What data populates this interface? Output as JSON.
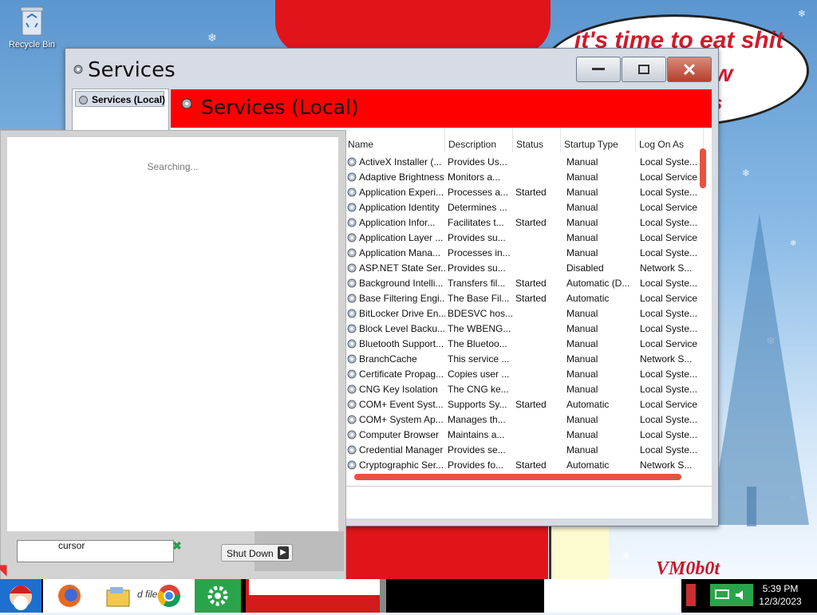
{
  "desktop": {
    "recycle_bin": "Recycle Bin",
    "bubble_line1": "it's time to eat shit",
    "bubble_line2": "hew",
    "bubble_line3": "s",
    "signature": "VM0b0t"
  },
  "window": {
    "title": "Services",
    "tree_item": "Services (Local)",
    "header": "Services (Local)",
    "columns": [
      "Name",
      "Description",
      "Status",
      "Startup Type",
      "Log On As"
    ],
    "rows": [
      [
        "ActiveX Installer (...",
        "Provides Us...",
        "",
        "Manual",
        "Local Syste..."
      ],
      [
        "Adaptive Brightness",
        "Monitors a...",
        "",
        "Manual",
        "Local Service"
      ],
      [
        "Application Experi...",
        "Processes a...",
        "Started",
        "Manual",
        "Local Syste..."
      ],
      [
        "Application Identity",
        "Determines ...",
        "",
        "Manual",
        "Local Service"
      ],
      [
        "Application Infor...",
        "Facilitates t...",
        "Started",
        "Manual",
        "Local Syste..."
      ],
      [
        "Application Layer ...",
        "Provides su...",
        "",
        "Manual",
        "Local Service"
      ],
      [
        "Application Mana...",
        "Processes in...",
        "",
        "Manual",
        "Local Syste..."
      ],
      [
        "ASP.NET State Ser...",
        "Provides su...",
        "",
        "Disabled",
        "Network S..."
      ],
      [
        "Background Intelli...",
        "Transfers fil...",
        "Started",
        "Automatic (D...",
        "Local Syste..."
      ],
      [
        "Base Filtering Engi...",
        "The Base Fil...",
        "Started",
        "Automatic",
        "Local Service"
      ],
      [
        "BitLocker Drive En...",
        "BDESVC hos...",
        "",
        "Manual",
        "Local Syste..."
      ],
      [
        "Block Level Backu...",
        "The WBENG...",
        "",
        "Manual",
        "Local Syste..."
      ],
      [
        "Bluetooth Support...",
        "The Bluetoo...",
        "",
        "Manual",
        "Local Service"
      ],
      [
        "BranchCache",
        "This service ...",
        "",
        "Manual",
        "Network S..."
      ],
      [
        "Certificate Propag...",
        "Copies user ...",
        "",
        "Manual",
        "Local Syste..."
      ],
      [
        "CNG Key Isolation",
        "The CNG ke...",
        "",
        "Manual",
        "Local Syste..."
      ],
      [
        "COM+ Event Syst...",
        "Supports Sy...",
        "Started",
        "Automatic",
        "Local Service"
      ],
      [
        "COM+ System Ap...",
        "Manages th...",
        "",
        "Manual",
        "Local Syste..."
      ],
      [
        "Computer Browser",
        "Maintains a...",
        "",
        "Manual",
        "Local Syste..."
      ],
      [
        "Credential Manager",
        "Provides se...",
        "",
        "Manual",
        "Local Syste..."
      ],
      [
        "Cryptographic Ser...",
        "Provides fo...",
        "Started",
        "Automatic",
        "Network S..."
      ]
    ]
  },
  "search_panel": {
    "status": "Searching...",
    "query": "cursor",
    "shutdown_label": "Shut Down"
  },
  "taskbar": {
    "snippet": "d files",
    "time": "5:39 PM",
    "date": "12/3/2023"
  }
}
